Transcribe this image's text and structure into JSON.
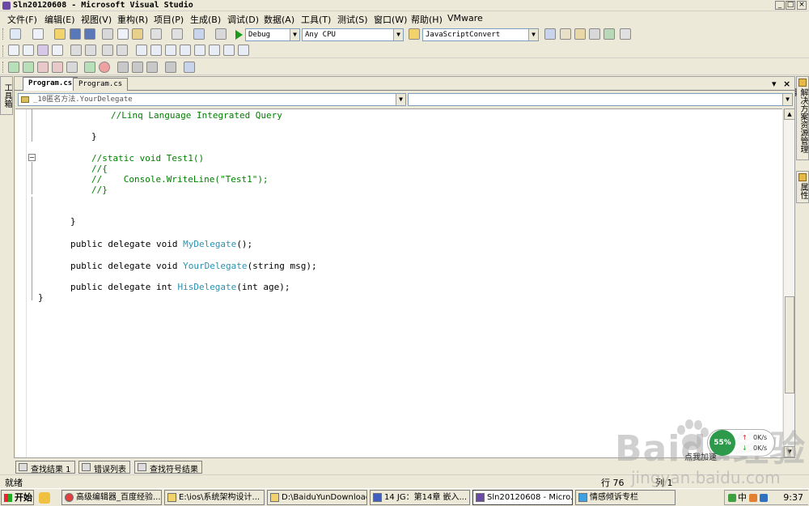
{
  "window": {
    "title": "Sln20120608 - Microsoft Visual Studio",
    "controls": {
      "minimize": "_",
      "maximize": "□",
      "close": "×"
    }
  },
  "menu": {
    "items": [
      "文件(F)",
      "编辑(E)",
      "视图(V)",
      "重构(R)",
      "项目(P)",
      "生成(B)",
      "调试(D)",
      "数据(A)",
      "工具(T)",
      "测试(S)",
      "窗口(W)",
      "帮助(H)",
      "VMware"
    ]
  },
  "toolbar": {
    "configuration": "Debug",
    "platform": "Any CPU",
    "find_combo": "JavaScriptConvert"
  },
  "side_tabs": {
    "left": "工具箱",
    "right_top": "解决方案资源管理器",
    "right_bottom": "属性"
  },
  "editor": {
    "tabs": [
      {
        "label": "Program.cs",
        "active": true
      },
      {
        "label": "Program.cs",
        "active": false
      }
    ],
    "tab_controls": {
      "dropdown": "▾",
      "close": "×"
    },
    "nav_type": "_10匿名方法.YourDelegate",
    "nav_member": "",
    "code_lines": {
      "l1": "//Linq Language Integrated Query",
      "l2": "}",
      "l3": "//static void Test1()",
      "l4": "//{",
      "l5a": "//    ",
      "l5b": "Console.WriteLine(\"Test1\");",
      "l6": "//}",
      "l7": "}",
      "d1_kw": "public delegate void ",
      "d1_ty": "MyDelegate",
      "d1_rest": "();",
      "d2_kw": "public delegate void ",
      "d2_ty": "YourDelegate",
      "d2_rest": "(string msg);",
      "d3_kw": "public delegate int ",
      "d3_ty": "HisDelegate",
      "d3_rest": "(int age);",
      "l8": "}"
    }
  },
  "bottom_tabs": [
    "查找结果 1",
    "错误列表",
    "查找符号结果"
  ],
  "status": {
    "text": "就绪",
    "line_label": "行 76",
    "col_label": "列 1"
  },
  "net_widget": {
    "percent": "55%",
    "up_speed": "0K/s",
    "down_speed": "0K/s",
    "label": "点我加速"
  },
  "watermark": {
    "brand": "Baidu经验",
    "url": "jingyan.baidu.com"
  },
  "taskbar": {
    "start": "开始",
    "tasks": [
      {
        "label": "高级编辑器_百度经验...",
        "active": false
      },
      {
        "label": "E:\\ios\\系统架构设计...",
        "active": false
      },
      {
        "label": "D:\\BaiduYunDownload...",
        "active": false
      },
      {
        "label": "14 JG：第14章 嵌入...",
        "active": false
      },
      {
        "label": "Sln20120608 - Micro...",
        "active": true
      },
      {
        "label": "情感倾诉专栏",
        "active": false
      }
    ],
    "tray_lang": "中",
    "clock": "9:37"
  },
  "colors": {
    "comment": "#008000",
    "keyword": "#0000ff",
    "type": "#2b91af",
    "chrome": "#ece9d8"
  }
}
